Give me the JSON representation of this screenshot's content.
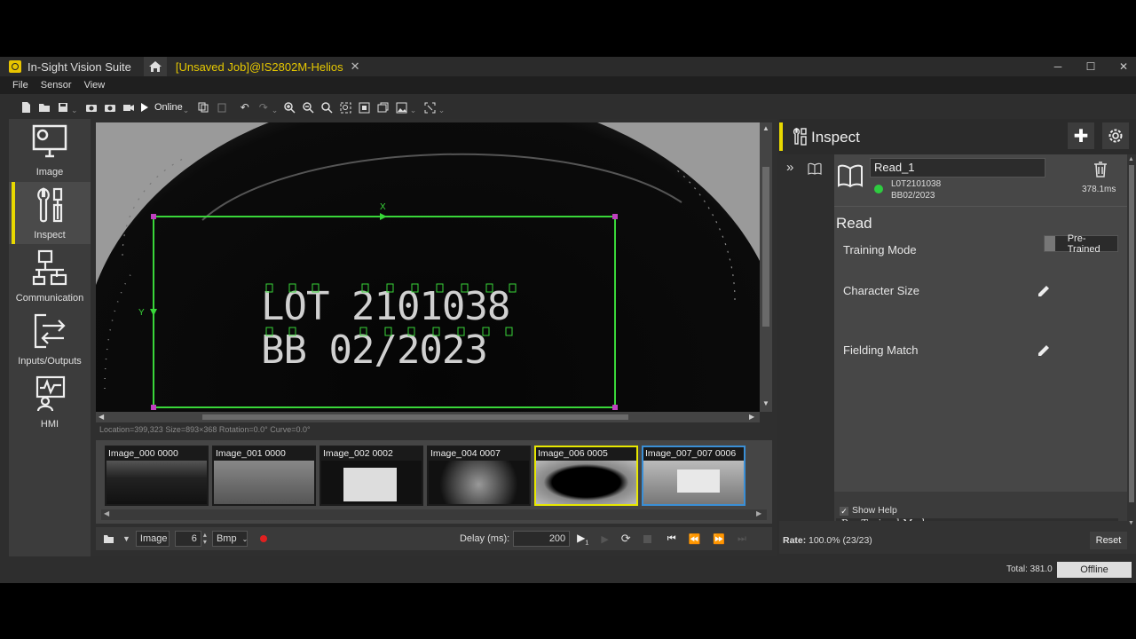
{
  "app": {
    "title": "In-Sight Vision Suite",
    "job_tab": "[Unsaved Job]@IS2802M-Helios"
  },
  "window_controls": {
    "minimize": "─",
    "maximize": "☐",
    "close": "✕"
  },
  "menu": [
    "File",
    "Sensor",
    "View"
  ],
  "toolbar": {
    "online_label": "Online"
  },
  "nav": [
    {
      "label": "Image",
      "icon": "monitor-gear-icon"
    },
    {
      "label": "Inspect",
      "icon": "tools-icon",
      "active": true
    },
    {
      "label": "Communication",
      "icon": "network-icon"
    },
    {
      "label": "Inputs/Outputs",
      "icon": "arrows-io-icon"
    },
    {
      "label": "HMI",
      "icon": "hmi-icon"
    }
  ],
  "viewer": {
    "axis_x": "X",
    "axis_y": "Y",
    "ocr_line1": "LOT 2101038",
    "ocr_line2": "BB 02/2023",
    "status": "Location=399,323 Size=893×368 Rotation=0.0° Curve=0.0°"
  },
  "filmstrip": [
    {
      "label": "Image_000 0000",
      "state": "normal"
    },
    {
      "label": "Image_001 0000",
      "state": "normal"
    },
    {
      "label": "Image_002 0002",
      "state": "normal"
    },
    {
      "label": "Image_004 0007",
      "state": "normal"
    },
    {
      "label": "Image_006 0005",
      "state": "yellow"
    },
    {
      "label": "Image_007_007 0006",
      "state": "blue"
    }
  ],
  "controls": {
    "source": "Image",
    "index": "6",
    "format": "Bmp",
    "delay_label": "Delay (ms):",
    "delay_value": "200"
  },
  "inspect": {
    "title": "Inspect",
    "tool_name": "Read_1",
    "result_line1": "L0T2101038",
    "result_line2": "BB02/2023",
    "time": "378.1ms",
    "section": "Read",
    "training_label": "Training Mode",
    "training_value": "Pre-Trained",
    "char_size": "Character Size",
    "fielding": "Fielding Match",
    "show_help": "Show Help",
    "help_text": "Pre-Trained Mode",
    "rate_label": "Rate:",
    "rate_value": "100.0% (23/23)",
    "reset": "Reset"
  },
  "status": {
    "total": "Total: 381.0",
    "mode": "Offline"
  },
  "colors": {
    "accent": "#e8d800",
    "roi": "#39d639",
    "handle": "#c040c0",
    "status_ok": "#2ecc40",
    "selected_blue": "#3a8fd6"
  }
}
